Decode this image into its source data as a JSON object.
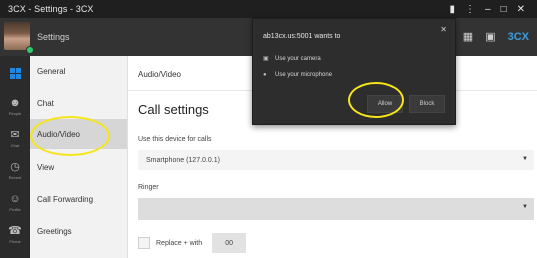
{
  "window": {
    "title": "3CX - Settings - 3CX",
    "buttons": [
      "▮",
      "⋮",
      "–",
      "□",
      "✕"
    ]
  },
  "header": {
    "title": "Settings",
    "icons": [
      "phone-icon",
      "dialpad-icon",
      "contacts-icon"
    ],
    "brand": "3CX"
  },
  "rail": {
    "items": [
      {
        "icon": "windows-logo-icon",
        "caption": ""
      },
      {
        "icon": "people-icon",
        "caption": "People"
      },
      {
        "icon": "chat-icon",
        "caption": "Chat"
      },
      {
        "icon": "recent-icon",
        "caption": "Recent"
      },
      {
        "icon": "profile-icon",
        "caption": "Profile"
      },
      {
        "icon": "phone-dialer-icon",
        "caption": "Phone"
      }
    ]
  },
  "menu": {
    "items": [
      "General",
      "Chat",
      "Audio/Video",
      "View",
      "Call Forwarding",
      "Greetings"
    ],
    "selected": "Audio/Video"
  },
  "main": {
    "breadcrumb": "Audio/Video",
    "title": "Call settings",
    "device_label": "Use this device for calls",
    "device_value": "Smartphone (127.0.0.1)",
    "ringer_label": "Ringer",
    "ringer_value": "",
    "replace_label": "Replace + with",
    "replace_value": "00"
  },
  "popup": {
    "title": "ab13cx.us:5001 wants to",
    "permissions": [
      "Use your camera",
      "Use your microphone"
    ],
    "allow": "Allow",
    "block": "Block",
    "close": "✕"
  },
  "colors": {
    "highlight": "#f5e51a",
    "brand": "#3b9ddd"
  }
}
